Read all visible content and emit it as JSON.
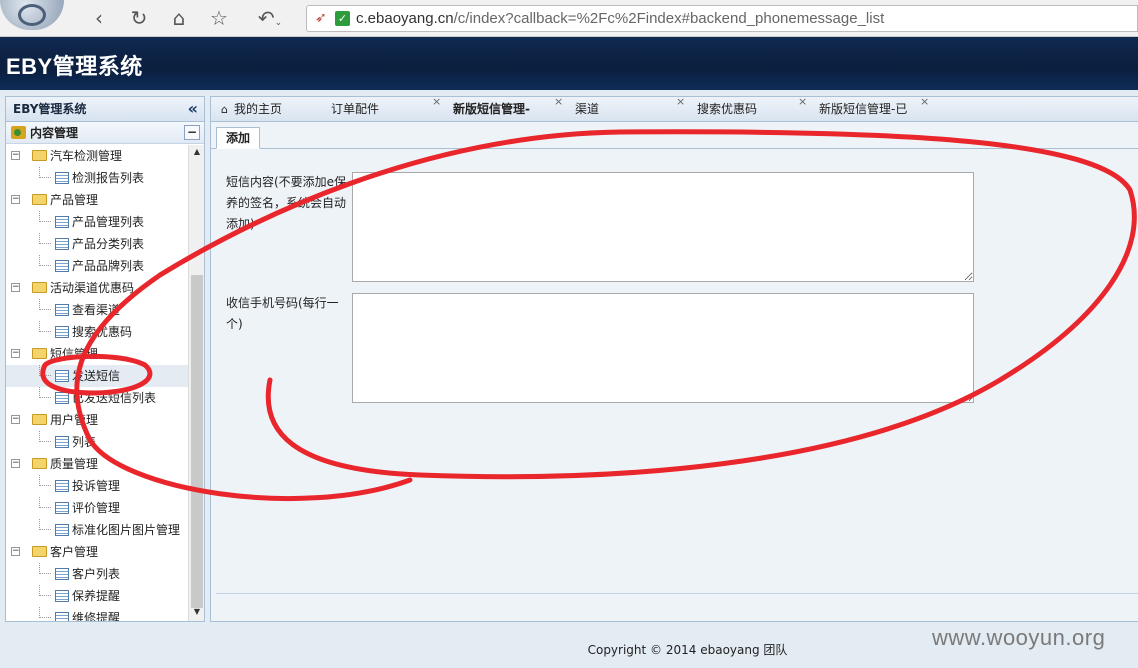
{
  "browser": {
    "url_domain": "c.ebaoyang.cn",
    "url_path": "/c/index?callback=%2Fc%2Findex#backend_phonemessage_list"
  },
  "app": {
    "title": "EBY管理系统"
  },
  "sidebar": {
    "header": "EBY管理系统",
    "collapse_icon": "«",
    "section": "内容管理",
    "tree": [
      {
        "type": "folder",
        "label": "汽车检测管理"
      },
      {
        "type": "leaf",
        "label": "检测报告列表"
      },
      {
        "type": "folder",
        "label": "产品管理"
      },
      {
        "type": "leaf",
        "label": "产品管理列表"
      },
      {
        "type": "leaf",
        "label": "产品分类列表"
      },
      {
        "type": "leaf",
        "label": "产品品牌列表"
      },
      {
        "type": "folder",
        "label": "活动渠道优惠码"
      },
      {
        "type": "leaf",
        "label": "查看渠道"
      },
      {
        "type": "leaf",
        "label": "搜索优惠码"
      },
      {
        "type": "folder",
        "label": "短信管理"
      },
      {
        "type": "leaf",
        "label": "发送短信",
        "selected": true
      },
      {
        "type": "leaf",
        "label": "已发送短信列表"
      },
      {
        "type": "folder",
        "label": "用户管理"
      },
      {
        "type": "leaf",
        "label": "列表"
      },
      {
        "type": "folder",
        "label": "质量管理"
      },
      {
        "type": "leaf",
        "label": "投诉管理"
      },
      {
        "type": "leaf",
        "label": "评价管理"
      },
      {
        "type": "leaf",
        "label": "标准化图片图片管理"
      },
      {
        "type": "folder",
        "label": "客户管理"
      },
      {
        "type": "leaf",
        "label": "客户列表"
      },
      {
        "type": "leaf",
        "label": "保养提醒"
      },
      {
        "type": "leaf",
        "label": "维修提醒"
      }
    ]
  },
  "tabs": [
    {
      "label": "我的主页",
      "icon": "home-icon"
    },
    {
      "label": "订单配件"
    },
    {
      "label": "新版短信管理-",
      "active": true
    },
    {
      "label": "渠道"
    },
    {
      "label": "搜索优惠码"
    },
    {
      "label": "新版短信管理-已"
    }
  ],
  "subtab": {
    "label": "添加"
  },
  "form": {
    "content_label": "短信内容(不要添加e保养的签名，系统会自动添加)",
    "content_value": "",
    "phones_label": "收信手机号码(每行一个)",
    "phones_value": ""
  },
  "footer": {
    "copyright": "Copyright © 2014 ebaoyang 团队"
  },
  "watermark": "www.wooyun.org",
  "colors": {
    "header_bg": "#0b1f3f",
    "panel_border": "#a9bfd6",
    "annotation": "#e8262b"
  }
}
